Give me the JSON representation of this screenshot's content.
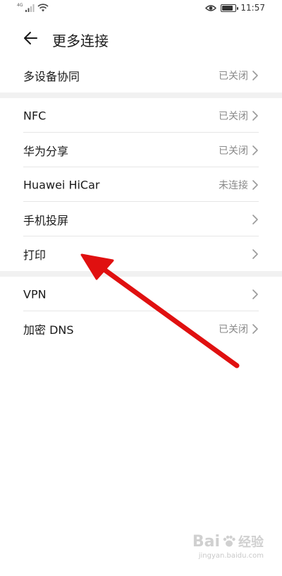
{
  "status_bar": {
    "network_type": "4G",
    "time": "11:57",
    "battery_level": 0.85
  },
  "header": {
    "title": "更多连接"
  },
  "sections": [
    {
      "items": [
        {
          "label": "多设备协同",
          "status": "已关闭"
        }
      ]
    },
    {
      "items": [
        {
          "label": "NFC",
          "status": "已关闭"
        },
        {
          "label": "华为分享",
          "status": "已关闭"
        },
        {
          "label": "Huawei HiCar",
          "status": "未连接"
        },
        {
          "label": "手机投屏",
          "status": ""
        },
        {
          "label": "打印",
          "status": ""
        }
      ]
    },
    {
      "items": [
        {
          "label": "VPN",
          "status": ""
        },
        {
          "label": "加密 DNS",
          "status": "已关闭"
        }
      ]
    }
  ],
  "annotation": {
    "arrow_color": "#e01010"
  },
  "watermark": {
    "brand": "Bai",
    "suffix": "经验",
    "url": "jingyan.baidu.com"
  }
}
